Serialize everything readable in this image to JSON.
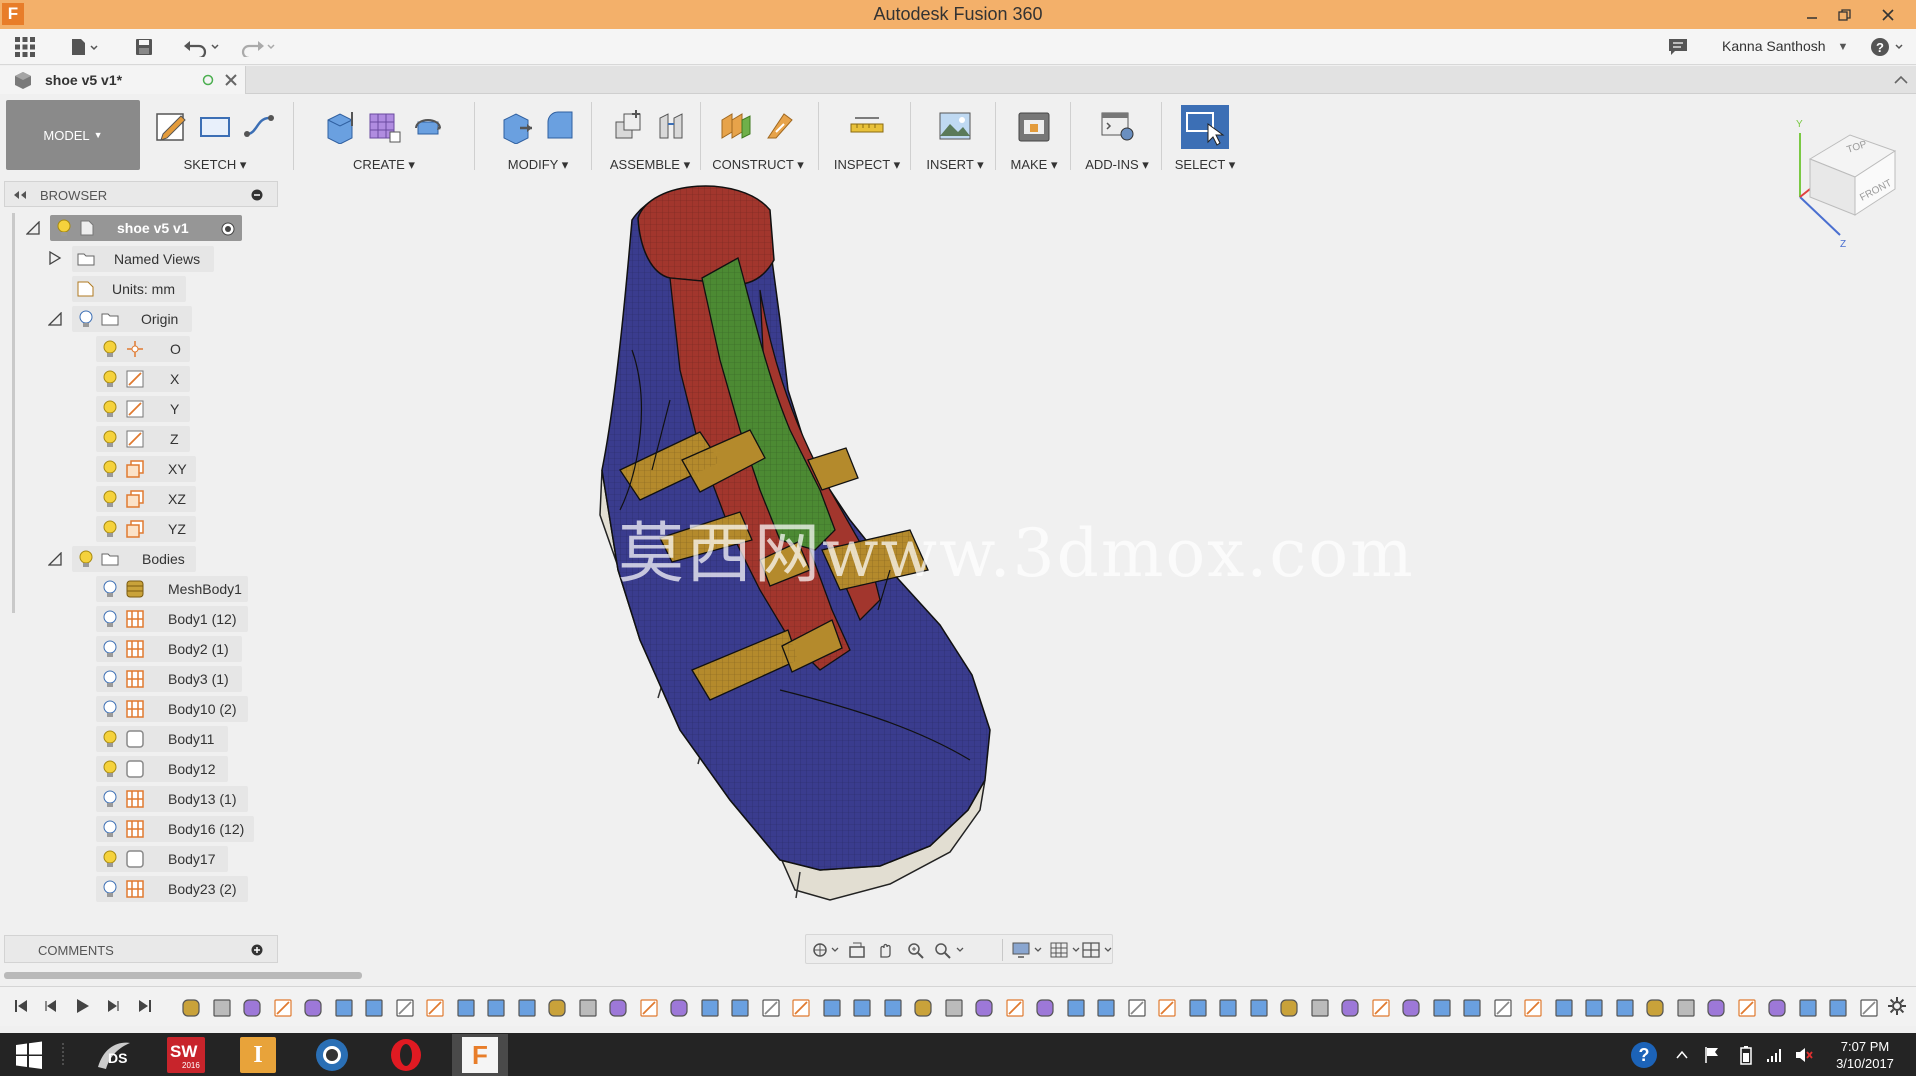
{
  "window": {
    "title": "Autodesk Fusion 360",
    "app_icon_letter": "F"
  },
  "user": {
    "name": "Kanna Santhosh"
  },
  "document_tab": {
    "label": "shoe v5 v1*"
  },
  "ribbon": {
    "workspace": "MODEL",
    "groups": [
      {
        "id": "sketch",
        "label": "SKETCH"
      },
      {
        "id": "create",
        "label": "CREATE"
      },
      {
        "id": "modify",
        "label": "MODIFY"
      },
      {
        "id": "assemble",
        "label": "ASSEMBLE"
      },
      {
        "id": "construct",
        "label": "CONSTRUCT"
      },
      {
        "id": "inspect",
        "label": "INSPECT"
      },
      {
        "id": "insert",
        "label": "INSERT"
      },
      {
        "id": "make",
        "label": "MAKE"
      },
      {
        "id": "addins",
        "label": "ADD-INS"
      },
      {
        "id": "select",
        "label": "SELECT"
      }
    ]
  },
  "viewcube": {
    "top": "TOP",
    "front": "FRONT",
    "axis_y": "Y",
    "axis_z": "Z"
  },
  "browser": {
    "title": "BROWSER",
    "root": "shoe v5 v1",
    "named_views": "Named Views",
    "units": "Units: mm",
    "origin": {
      "label": "Origin",
      "items": [
        "O",
        "X",
        "Y",
        "Z",
        "XY",
        "XZ",
        "YZ"
      ]
    },
    "bodies": {
      "label": "Bodies",
      "items": [
        "MeshBody1",
        "Body1 (12)",
        "Body2 (1)",
        "Body3 (1)",
        "Body10 (2)",
        "Body11",
        "Body12",
        "Body13 (1)",
        "Body16 (12)",
        "Body17",
        "Body23 (2)"
      ]
    }
  },
  "comments": {
    "title": "COMMENTS"
  },
  "watermark": "莫西网www.3dmox.com",
  "taskbar": {
    "time": "7:07 PM",
    "date": "3/10/2017",
    "sw_badge": "SW",
    "sw_year": "2016",
    "inventor_letter": "I",
    "fusion_letter": "F"
  },
  "colors": {
    "titlebar": "#f3b06a",
    "accent_blue": "#3c6fb5",
    "shoe_blue": "#3a3c8e",
    "shoe_red": "#a2362d",
    "shoe_green": "#4c8a33",
    "shoe_gold": "#b48a2c",
    "sole": "#e2ded2"
  }
}
